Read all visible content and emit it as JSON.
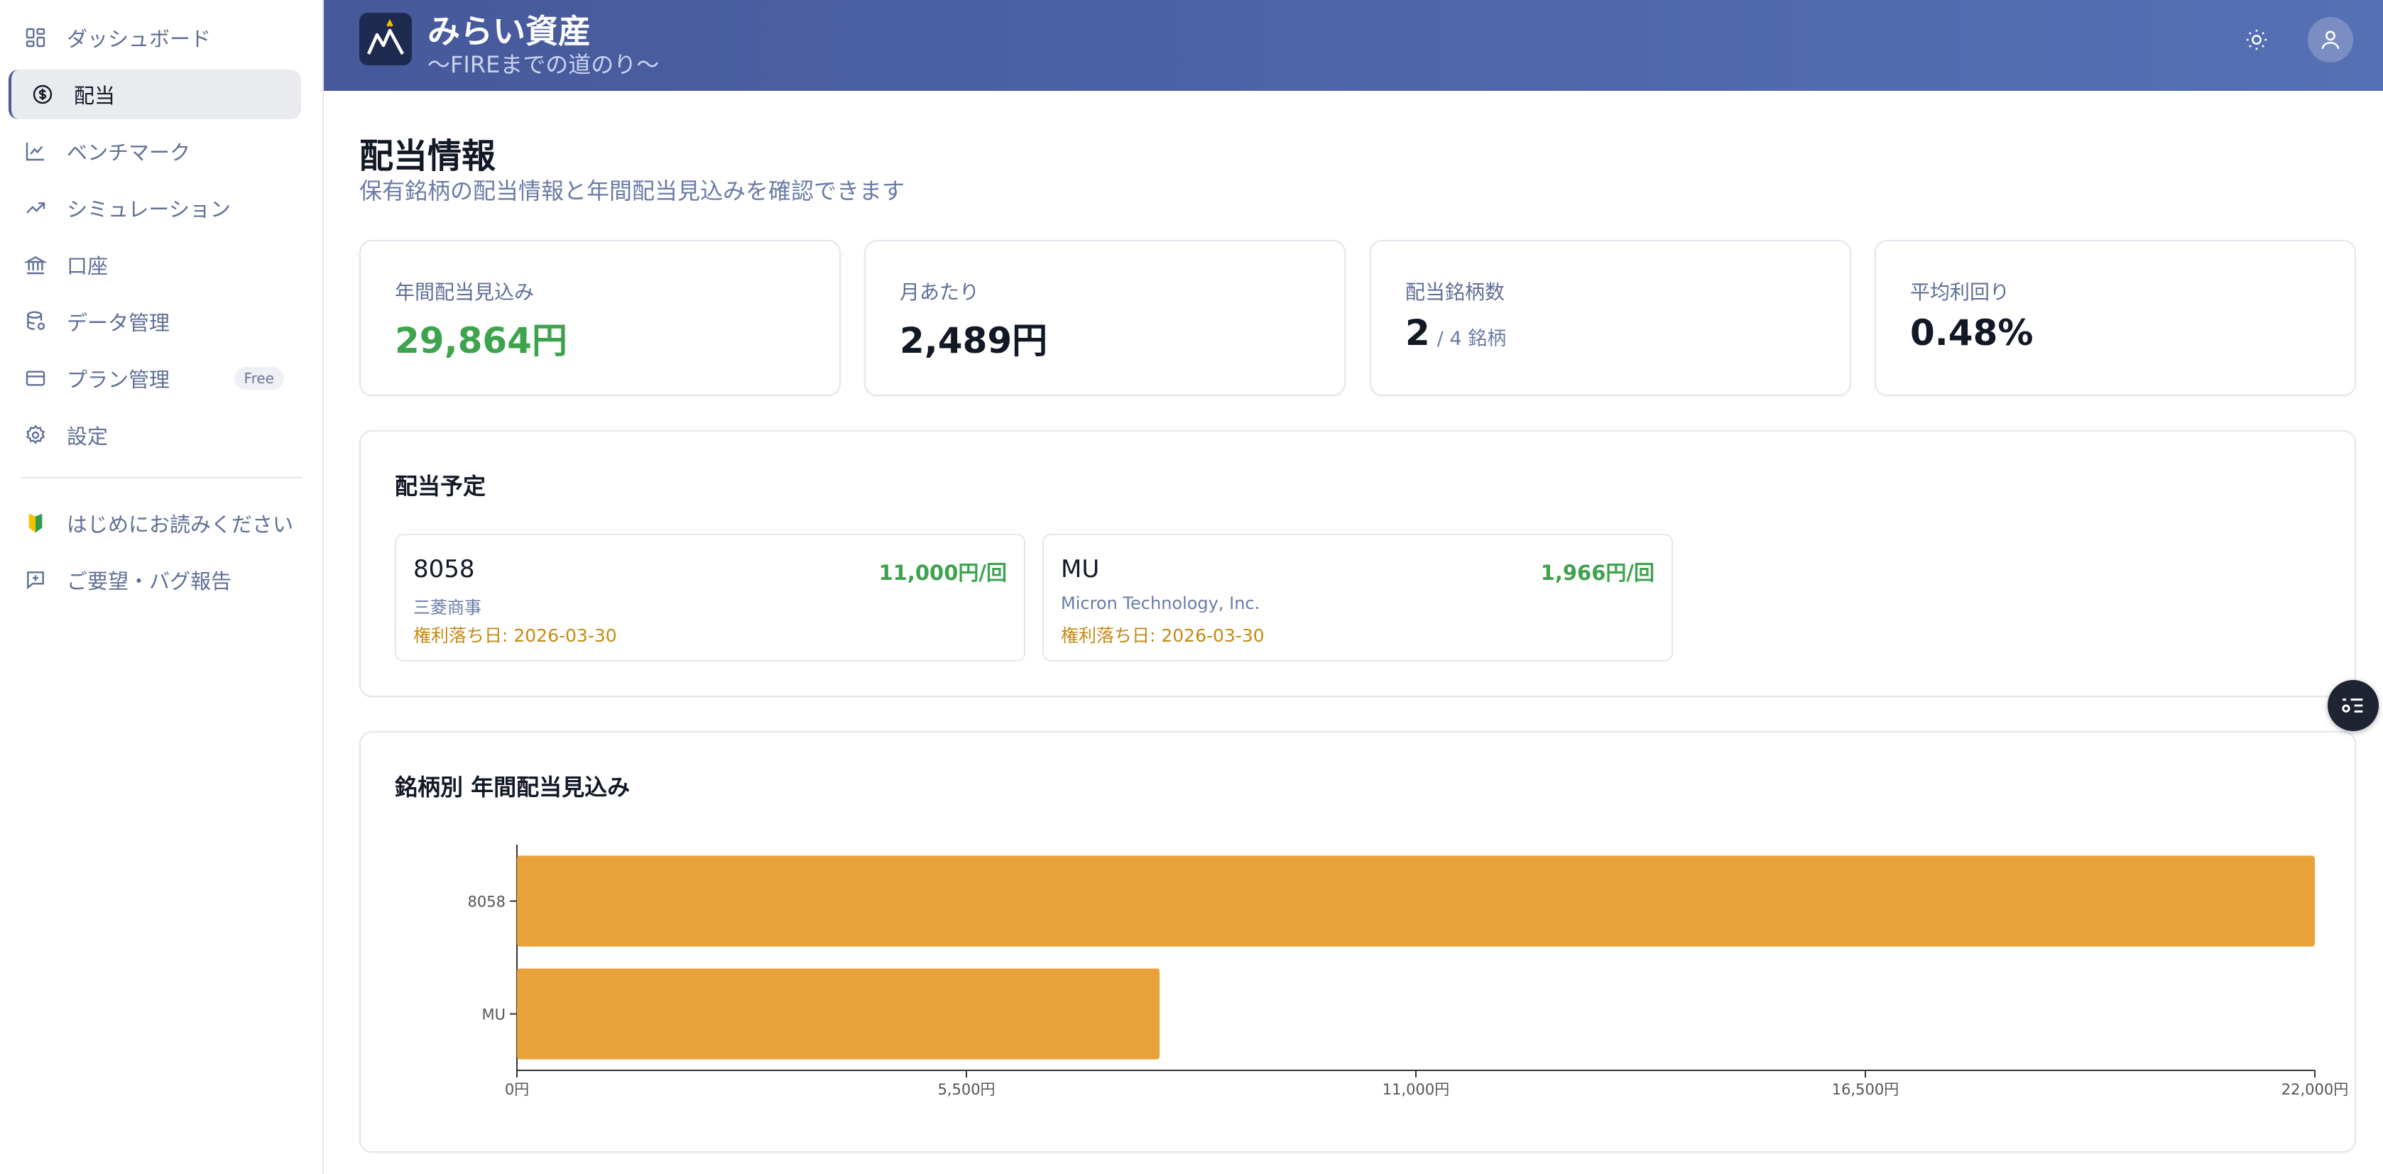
{
  "app": {
    "title": "みらい資産",
    "subtitle": "〜FIREまでの道のり〜"
  },
  "sidebar": {
    "items": [
      {
        "label": "ダッシュボード",
        "icon": "grid-icon"
      },
      {
        "label": "配当",
        "icon": "dollar-circle-icon",
        "active": true
      },
      {
        "label": "ベンチマーク",
        "icon": "line-chart-icon"
      },
      {
        "label": "シミュレーション",
        "icon": "trending-up-icon"
      },
      {
        "label": "口座",
        "icon": "bank-icon"
      },
      {
        "label": "データ管理",
        "icon": "database-icon"
      },
      {
        "label": "プラン管理",
        "icon": "credit-card-icon",
        "badge": "Free"
      },
      {
        "label": "設定",
        "icon": "gear-icon"
      }
    ],
    "secondary": [
      {
        "label": "はじめにお読みください",
        "icon": "beginner-leaf-icon"
      },
      {
        "label": "ご要望・バグ報告",
        "icon": "message-plus-icon"
      }
    ]
  },
  "page": {
    "title": "配当情報",
    "description": "保有銘柄の配当情報と年間配当見込みを確認できます"
  },
  "stats": [
    {
      "label": "年間配当見込み",
      "value": "29,864円"
    },
    {
      "label": "月あたり",
      "value": "2,489円"
    },
    {
      "label": "配当銘柄数",
      "value": "2",
      "sub": "/ 4 銘柄"
    },
    {
      "label": "平均利回り",
      "value": "0.48%"
    }
  ],
  "schedule": {
    "title": "配当予定",
    "items": [
      {
        "code": "8058",
        "amount": "11,000円/回",
        "name": "三菱商事",
        "date": "権利落ち日: 2026-03-30"
      },
      {
        "code": "MU",
        "amount": "1,966円/回",
        "name": "Micron Technology, Inc.",
        "date": "権利落ち日: 2026-03-30"
      }
    ]
  },
  "colors": {
    "accent_green": "#3ea34d",
    "bar": "#e8a23a",
    "date_text": "#c48a14",
    "header": "#4b5ea3"
  },
  "chart_data": {
    "type": "bar",
    "orientation": "horizontal",
    "title": "銘柄別 年間配当見込み",
    "categories": [
      "8058",
      "MU"
    ],
    "values": [
      22000,
      7864
    ],
    "xlim": [
      0,
      22000
    ],
    "xticks": [
      "0円",
      "5,500円",
      "11,000円",
      "16,500円",
      "22,000円"
    ],
    "xtick_values": [
      0,
      5500,
      11000,
      16500,
      22000
    ],
    "grid": false
  }
}
